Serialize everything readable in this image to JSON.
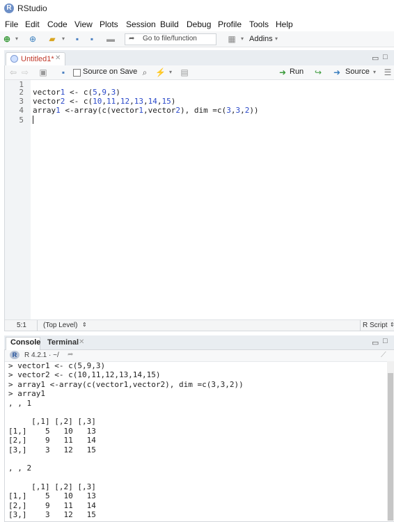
{
  "window": {
    "title": "RStudio",
    "logo_letter": "R"
  },
  "menu": [
    "File",
    "Edit",
    "Code",
    "View",
    "Plots",
    "Session",
    "Build",
    "Debug",
    "Profile",
    "Tools",
    "Help"
  ],
  "toolbar": {
    "goto_placeholder": "Go to file/function",
    "addins_label": "Addins"
  },
  "editor": {
    "tab_label": "Untitled1*",
    "source_on_save_label": "Source on Save",
    "run_label": "Run",
    "source_label": "Source",
    "line_numbers": [
      "1",
      "2",
      "3",
      "4",
      "5"
    ],
    "lines": [
      "",
      "vector1 <- c(5,9,3)",
      "vector2 <- c(10,11,12,13,14,15)",
      "array1 <-array(c(vector1,vector2), dim =c(3,3,2))",
      ""
    ],
    "status_position": "5:1",
    "status_scope": "(Top Level)",
    "status_type": "R Script"
  },
  "console": {
    "tab_console": "Console",
    "tab_terminal": "Terminal",
    "r_version": "R 4.2.1 · ~/",
    "lines": [
      "> vector1 <- c(5,9,3)",
      "> vector2 <- c(10,11,12,13,14,15)",
      "> array1 <-array(c(vector1,vector2), dim =c(3,3,2))",
      "> array1",
      ", , 1",
      "",
      "     [,1] [,2] [,3]",
      "[1,]    5   10   13",
      "[2,]    9   11   14",
      "[3,]    3   12   15",
      "",
      ", , 2",
      "",
      "     [,1] [,2] [,3]",
      "[1,]    5   10   13",
      "[2,]    9   11   14",
      "[3,]    3   12   15"
    ]
  }
}
